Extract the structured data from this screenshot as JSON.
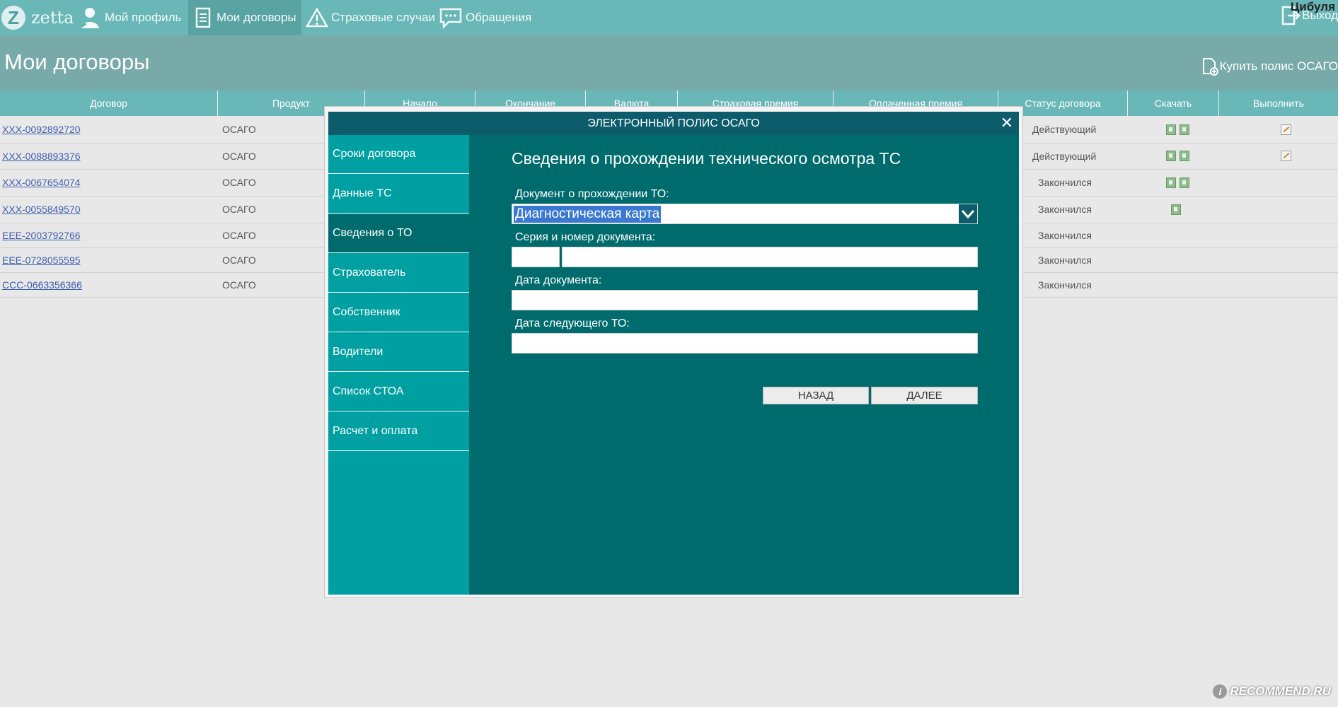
{
  "brand": {
    "logo_letter": "Z",
    "name": "zetta"
  },
  "nav": {
    "items": [
      {
        "label": "Мой профиль",
        "icon": "profile-icon"
      },
      {
        "label": "Мои договоры",
        "icon": "document-icon",
        "active": true
      },
      {
        "label": "Страховые случаи",
        "icon": "warning-icon"
      },
      {
        "label": "Обращения",
        "icon": "chat-icon"
      }
    ],
    "user_name": "Цибуля",
    "logout_label": "Выход"
  },
  "header": {
    "title": "Мои договоры",
    "buy_label": "Купить полис ОСАГО"
  },
  "table": {
    "columns": [
      "Договор",
      "Продукт",
      "Начало",
      "Окончание",
      "Валюта",
      "Страховая премия",
      "Оплаченная премия",
      "Статус договора",
      "Скачать",
      "Выполнить"
    ],
    "rows": [
      {
        "contract": "XXX-0092892720",
        "product": "ОСАГО",
        "status": "Действующий",
        "downloads": 2,
        "edit": true
      },
      {
        "contract": "XXX-0088893376",
        "product": "ОСАГО",
        "status": "Действующий",
        "downloads": 2,
        "edit": true
      },
      {
        "contract": "XXX-0067654074",
        "product": "ОСАГО",
        "status": "Закончился",
        "downloads": 2,
        "edit": false
      },
      {
        "contract": "XXX-0055849570",
        "product": "ОСАГО",
        "status": "Закончился",
        "downloads": 1,
        "edit": false
      },
      {
        "contract": "EEE-2003792766",
        "product": "ОСАГО",
        "status": "Закончился",
        "downloads": 0,
        "edit": false
      },
      {
        "contract": "EEE-0728055595",
        "product": "ОСАГО",
        "status": "Закончился",
        "downloads": 0,
        "edit": false
      },
      {
        "contract": "CCC-0663356366",
        "product": "ОСАГО",
        "status": "Закончился",
        "downloads": 0,
        "edit": false
      }
    ]
  },
  "modal": {
    "title": "ЭЛЕКТРОННЫЙ ПОЛИС ОСАГО",
    "close_symbol": "✕",
    "steps": [
      "Сроки договора",
      "Данные ТС",
      "Сведения о ТО",
      "Страхователь",
      "Собственник",
      "Водители",
      "Список СТОА",
      "Расчет и оплата"
    ],
    "active_step": "Сведения о ТО",
    "form": {
      "title": "Сведения о прохождении технического осмотра ТС",
      "doc_type_label": "Документ о прохождении ТО:",
      "doc_type_value": "Диагностическая карта",
      "series_number_label": "Серия и  номер документа:",
      "series_value": "",
      "number_value": "",
      "doc_date_label": "Дата документа:",
      "doc_date_value": "",
      "next_date_label": "Дата следующего ТО:",
      "next_date_value": ""
    },
    "buttons": {
      "back": "НАЗАД",
      "next": "ДАЛЕЕ"
    }
  },
  "watermark": {
    "text": "RECOMMEND.RU",
    "badge": "i"
  },
  "colors": {
    "nav": "#6ab7b7",
    "header": "#78aaaa",
    "modal_title": "#0c5c6b",
    "modal_body": "#006b6d",
    "sidebar": "#009fa2",
    "selection": "#3b78d0",
    "link": "#3f5fb0"
  }
}
